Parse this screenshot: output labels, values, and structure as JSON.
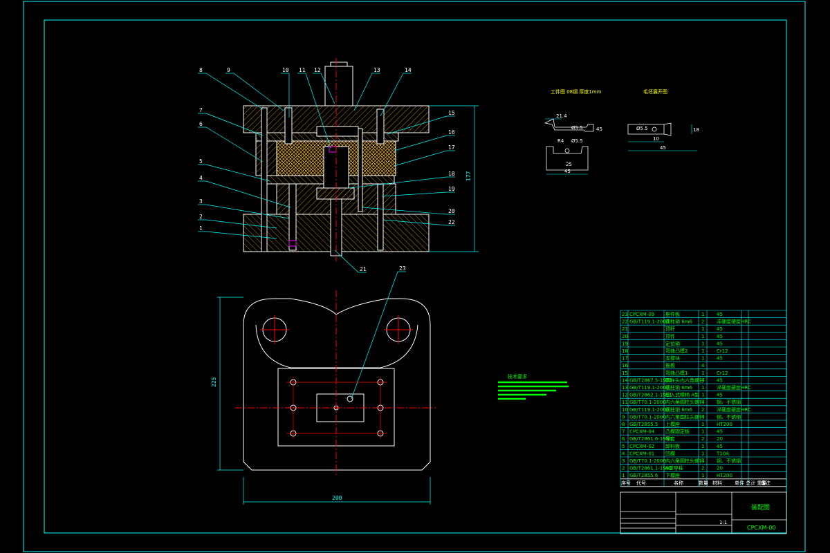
{
  "colors": {
    "background": "#000000",
    "frame": "#00ffff",
    "part": "#ffffff",
    "hatch": "#b8860b",
    "leader": "#00ffff",
    "center": "#ff0000",
    "text": "#00ff00",
    "dims": "#00ffff"
  },
  "callouts": [
    "1",
    "2",
    "3",
    "4",
    "5",
    "6",
    "7",
    "8",
    "9",
    "10",
    "11",
    "12",
    "13",
    "14",
    "15",
    "16",
    "17",
    "18",
    "19",
    "20",
    "21",
    "22",
    "23"
  ],
  "section": {
    "height_dim": "177"
  },
  "plan": {
    "width_dim": "200",
    "height_dim": "225"
  },
  "workpiece": {
    "title": "工件图  08钢  厚度1mm",
    "dims": [
      "21.4",
      "Ø5.5",
      "45",
      "R4",
      "Ø5.5",
      "25",
      "45"
    ]
  },
  "blank": {
    "title": "毛坯展开图",
    "dims": [
      "Ø5.5",
      "18",
      "10",
      "45"
    ]
  },
  "notes": {
    "title": "技术要求"
  },
  "bom": {
    "rows": [
      [
        "23",
        "CPCXM-09",
        "推件板",
        "1",
        "45"
      ],
      [
        "22",
        "GB/T119.1-2000",
        "圆柱销 6m6",
        "2",
        "淬硬度硬度HRC"
      ],
      [
        "21",
        "",
        "顶杆",
        "1",
        "45"
      ],
      [
        "20",
        "",
        "顶件",
        "1",
        "45"
      ],
      [
        "19",
        "",
        "定位销",
        "1",
        "45"
      ],
      [
        "18",
        "",
        "弯曲凸模2",
        "1",
        "Cr12"
      ],
      [
        "17",
        "",
        "支撑块",
        "1",
        "45"
      ],
      [
        "16",
        "",
        "推板",
        "4",
        ""
      ],
      [
        "15",
        "",
        "弯曲凸模1",
        "1",
        "Cr12"
      ],
      [
        "14",
        "GB/T2867.5-1981",
        "圆柱头内六角螺钉",
        "4",
        "45"
      ],
      [
        "13",
        "GB/T119.1-2000",
        "圆柱销 6m6",
        "1",
        "淬硬度硬度HRC"
      ],
      [
        "12",
        "GB/T2862.1-1981",
        "压入式模柄 A型",
        "1",
        "45"
      ],
      [
        "11",
        "GB/T70.1-2000",
        "内六角圆柱头螺钉",
        "4",
        "钢、不锈钢"
      ],
      [
        "10",
        "GB/T119.1-2000",
        "圆柱销 6m6",
        "2",
        "淬硬度硬度HRC"
      ],
      [
        "9",
        "GB/T70.1-2000",
        "内六角圆柱头螺钉",
        "4",
        "钢、不锈钢"
      ],
      [
        "8",
        "GB/T2855.5",
        "上模座",
        "1",
        "HT200"
      ],
      [
        "7",
        "CPCXM-04",
        "凸模固定板",
        "1",
        "45"
      ],
      [
        "6",
        "GB/T2861.6-1990",
        "导套",
        "2",
        "20"
      ],
      [
        "5",
        "CPCXM-02",
        "卸料板",
        "1",
        "45"
      ],
      [
        "4",
        "CPCXM-01",
        "凹模",
        "1",
        "T10A"
      ],
      [
        "3",
        "GB/T70.1-2000",
        "内六角圆柱头螺钉",
        "4",
        "钢、不锈钢"
      ],
      [
        "2",
        "GB/T2861.1-1990",
        "A型导柱",
        "2",
        "20"
      ],
      [
        "1",
        "GB/T2855.6",
        "下模座",
        "1",
        "HT200"
      ]
    ],
    "header": [
      "序号",
      "代号",
      "名称",
      "数量",
      "材料",
      "单件 总计 重量",
      "备注"
    ],
    "drawing_title": "装配图",
    "drawing_code": "CPCXM-00",
    "scale": "1:1"
  }
}
